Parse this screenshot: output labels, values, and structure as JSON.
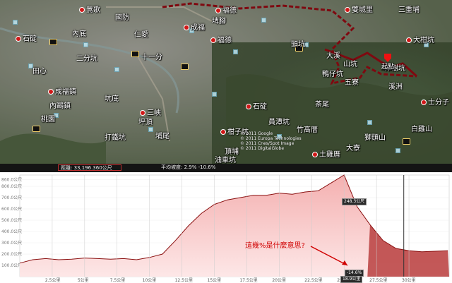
{
  "map": {
    "places": [
      {
        "name": "鶯歌"
      },
      {
        "name": "國防"
      },
      {
        "name": "福德"
      },
      {
        "name": "埤腳"
      },
      {
        "name": "雙城里"
      },
      {
        "name": "三重埔"
      },
      {
        "name": "成福"
      },
      {
        "name": "仁愛"
      },
      {
        "name": "內底"
      },
      {
        "name": "石碇"
      },
      {
        "name": "福德"
      },
      {
        "name": "頭坑"
      },
      {
        "name": "大柑坑"
      },
      {
        "name": "二分坑"
      },
      {
        "name": "十一分"
      },
      {
        "name": "大溪"
      },
      {
        "name": "山坑"
      },
      {
        "name": "鴨仔坑"
      },
      {
        "name": "樟樹坑"
      },
      {
        "name": "五寮"
      },
      {
        "name": "溪洲"
      },
      {
        "name": "田心"
      },
      {
        "name": "成福鎮"
      },
      {
        "name": "內鷗鎮"
      },
      {
        "name": "坑底"
      },
      {
        "name": "三峽"
      },
      {
        "name": "坪頂"
      },
      {
        "name": "桃園"
      },
      {
        "name": "石碇"
      },
      {
        "name": "茶尾"
      },
      {
        "name": "士分子"
      },
      {
        "name": "員潭坑"
      },
      {
        "name": "柑子坑"
      },
      {
        "name": "竹高厝"
      },
      {
        "name": "打鐵坑"
      },
      {
        "name": "土雞厝"
      },
      {
        "name": "頂埔"
      },
      {
        "name": "油車坑"
      },
      {
        "name": "大寮"
      },
      {
        "name": "白雞山"
      },
      {
        "name": "獅頭山"
      },
      {
        "name": "埔尾"
      }
    ],
    "overlay_copyright": "© 2011 Google\n© 2011 Europa Technologies\n© 2011 Cnes/Spot Image\n© 2011 DigitalGlobe",
    "track_marker": "起點"
  },
  "stats": {
    "distance_label": "距離: 33,196.360公尺",
    "grade_label": "平均坡度: 2.9% -10.6%"
  },
  "chart_data": {
    "type": "area",
    "title": "",
    "xlabel": "",
    "ylabel": "",
    "ylim": [
      0,
      900
    ],
    "y_ticks": [
      "860.0公尺",
      "800.0公尺",
      "700.0公尺",
      "600.0公尺",
      "500.0公尺",
      "400.0公尺",
      "300.0公尺",
      "200.0公尺",
      "100.0公尺"
    ],
    "x_ticks": [
      "2.5公里",
      "5公里",
      "7.5公里",
      "10公里",
      "12.5公里",
      "15公里",
      "17.5公里",
      "20公里",
      "22.5公里",
      "25公里",
      "27.5公里",
      "30公里"
    ],
    "x": [
      0,
      1,
      2,
      3,
      4,
      5,
      6,
      7,
      8,
      9,
      10,
      11,
      12,
      13,
      14,
      15,
      16,
      17,
      18,
      19,
      20,
      21,
      22,
      23,
      24,
      25,
      26,
      27,
      28,
      29,
      30,
      31,
      32,
      33
    ],
    "values": [
      120,
      150,
      160,
      150,
      155,
      165,
      160,
      155,
      160,
      150,
      170,
      200,
      320,
      450,
      560,
      640,
      680,
      700,
      720,
      720,
      740,
      730,
      750,
      760,
      830,
      900,
      620,
      460,
      320,
      250,
      230,
      220,
      225,
      230
    ],
    "highlight": {
      "from_km": 26.8,
      "to_km": 33.1,
      "selected_km": 29.6,
      "marker_label": "248.3公尺",
      "distance_label": "18.9公里",
      "grade_label": "-14.6%"
    }
  },
  "annotation": {
    "text": "這幾%是什麼意思?"
  }
}
